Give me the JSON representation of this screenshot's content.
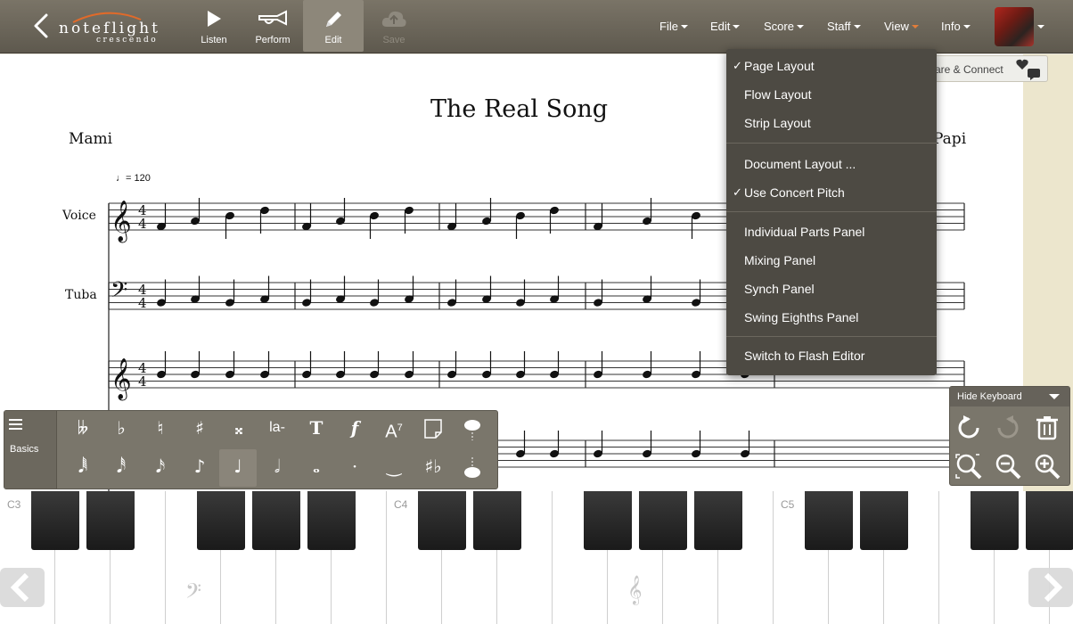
{
  "app": {
    "logo_brand": "noteflight",
    "logo_sub": "crescendo"
  },
  "toolbar": {
    "buttons": [
      {
        "label": "Listen"
      },
      {
        "label": "Perform"
      },
      {
        "label": "Edit"
      },
      {
        "label": "Save"
      }
    ],
    "menus": [
      "File",
      "Edit",
      "Score",
      "Staff",
      "View",
      "Info"
    ]
  },
  "score": {
    "title": "The Real Song",
    "composer_left": "Mami",
    "composer_right": "Papi",
    "tempo": "= 120",
    "instruments": [
      "Voice",
      "Tuba"
    ],
    "share_label": "are & Connect"
  },
  "view_menu": {
    "items": [
      {
        "label": "Page Layout",
        "checked": true
      },
      {
        "label": "Flow Layout",
        "checked": false
      },
      {
        "label": "Strip Layout",
        "checked": false
      },
      {
        "label": "Document Layout ...",
        "checked": false
      },
      {
        "label": "Use Concert Pitch",
        "checked": true
      },
      {
        "label": "Individual Parts Panel",
        "checked": false
      },
      {
        "label": "Mixing Panel",
        "checked": false
      },
      {
        "label": "Synch Panel",
        "checked": false
      },
      {
        "label": "Swing Eighths Panel",
        "checked": false
      },
      {
        "label": "Switch to Flash Editor",
        "checked": false
      }
    ],
    "check_glyph": "✓"
  },
  "palette": {
    "category": "Basics",
    "row1": [
      "𝄫",
      "♭",
      "♮",
      "♯",
      "𝄪",
      "la-",
      "T",
      "f",
      "A7",
      "note-icon",
      "bubble-icon"
    ],
    "row2": [
      "𝅘𝅥𝅱",
      "𝅘𝅥𝅰",
      "𝅘𝅥𝅯",
      "♪",
      "♩",
      "𝅗𝅥",
      "𝅝",
      "·",
      "‿",
      "♯♭",
      "voice-icon"
    ],
    "text_glyphs": {
      "lyric": "la-",
      "text": "T",
      "dynamic": "f",
      "chord": "A"
    }
  },
  "tools": {
    "hide_keyboard": "Hide Keyboard"
  },
  "keyboard": {
    "octave_labels": [
      "C3",
      "C4",
      "C5"
    ]
  }
}
